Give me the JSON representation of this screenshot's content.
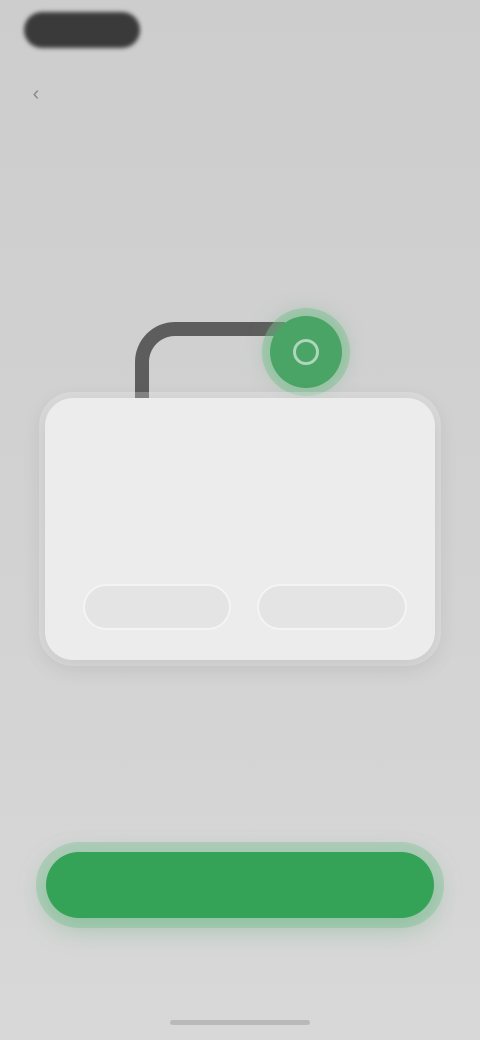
{
  "header": {
    "back_icon": "chevron-left-icon",
    "title": "",
    "subtitle": ""
  },
  "illustration": {
    "cable_icon": "cable-icon",
    "indicator_icon": "green-connection-icon",
    "indicator_color": "#4aa466"
  },
  "dialog": {
    "title": "",
    "body": "",
    "left_button_label": "",
    "right_button_label": ""
  },
  "helper_text": "",
  "primary_button": {
    "label": "",
    "color": "#34a257"
  },
  "secondary_link": ""
}
